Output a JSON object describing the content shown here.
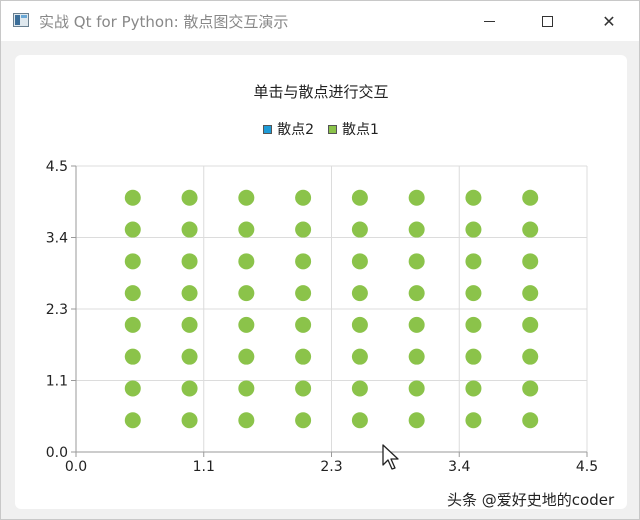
{
  "window": {
    "title": "实战 Qt for Python: 散点图交互演示",
    "icon": "app-window-icon",
    "controls": {
      "minimize": "minimize-icon",
      "maximize": "maximize-icon",
      "close": "close-icon",
      "close_glyph": "✕"
    }
  },
  "chart": {
    "title": "单击与散点进行交互",
    "legend": [
      {
        "name": "散点2",
        "color": "#1e9bd7"
      },
      {
        "name": "散点1",
        "color": "#8bc34a"
      }
    ]
  },
  "chart_data": {
    "type": "scatter",
    "title": "单击与散点进行交互",
    "xlabel": "",
    "ylabel": "",
    "xlim": [
      0.0,
      4.5
    ],
    "ylim": [
      0.0,
      4.5
    ],
    "x_ticks": [
      "0.0",
      "1.1",
      "2.3",
      "3.4",
      "4.5"
    ],
    "y_ticks": [
      "0.0",
      "1.1",
      "2.3",
      "3.4",
      "4.5"
    ],
    "grid": true,
    "legend_position": "top-center",
    "series": [
      {
        "name": "散点2",
        "color": "#1e9bd7",
        "points": []
      },
      {
        "name": "散点1",
        "color": "#8bc34a",
        "x": [
          0.5,
          1.0,
          1.5,
          2.0,
          2.5,
          3.0,
          3.5,
          4.0
        ],
        "y": [
          0.5,
          1.0,
          1.5,
          2.0,
          2.5,
          3.0,
          3.5,
          4.0
        ]
      }
    ]
  },
  "watermark": "头条 @爱好史地的coder"
}
